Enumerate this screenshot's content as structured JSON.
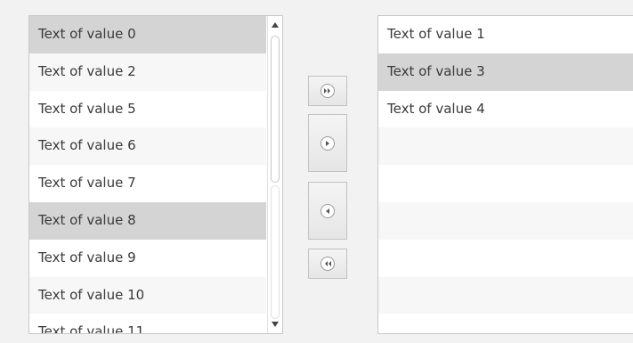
{
  "left_list": {
    "items": [
      {
        "label": "Text of value 0",
        "selected": true
      },
      {
        "label": "Text of value 2",
        "selected": false
      },
      {
        "label": "Text of value 5",
        "selected": false
      },
      {
        "label": "Text of value 6",
        "selected": false
      },
      {
        "label": "Text of value 7",
        "selected": false
      },
      {
        "label": "Text of value 8",
        "selected": true
      },
      {
        "label": "Text of value 9",
        "selected": false
      },
      {
        "label": "Text of value 10",
        "selected": false
      },
      {
        "label": "Text of value 11",
        "selected": false
      }
    ],
    "scroll_up_icon": "triangle-up",
    "scroll_down_icon": "triangle-down"
  },
  "buttons": {
    "move_all_right_icon": "double-chevron-right",
    "move_right_icon": "chevron-right",
    "move_left_icon": "chevron-left",
    "move_all_left_icon": "double-chevron-left"
  },
  "right_list": {
    "items": [
      {
        "label": "Text of value 1",
        "selected": false
      },
      {
        "label": "Text of value 3",
        "selected": true
      },
      {
        "label": "Text of value 4",
        "selected": false
      }
    ]
  },
  "colors": {
    "background": "#f2f2f2",
    "selected_row": "#d4d4d4",
    "alt_row": "#f7f7f7",
    "border": "#c8c8c8",
    "text": "#3a3a3a"
  }
}
